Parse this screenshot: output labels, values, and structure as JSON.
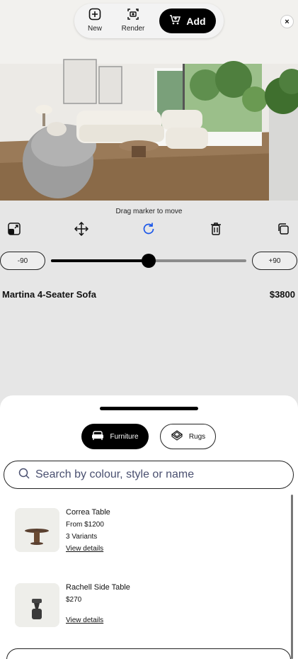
{
  "toolbar": {
    "new_label": "New",
    "render_label": "Render",
    "add_label": "Add"
  },
  "close": {
    "symbol": "×"
  },
  "hint": "Drag marker to move",
  "rotation": {
    "min_label": "-90",
    "max_label": "+90",
    "value_fraction": 0.5
  },
  "selected_product": {
    "name": "Martina 4-Seater Sofa",
    "price": "$3800"
  },
  "tabs": [
    {
      "label": "Furniture",
      "active": true
    },
    {
      "label": "Rugs",
      "active": false
    }
  ],
  "search": {
    "placeholder": "Search by colour, style or name"
  },
  "products": [
    {
      "title": "Correa Table",
      "price": "From $1200",
      "variants": "3 Variants",
      "link": "View details"
    },
    {
      "title": "Rachell Side Table",
      "price": "$270",
      "link": "View details"
    }
  ],
  "colors": {
    "accent_blue": "#1a56e8",
    "black": "#000000"
  },
  "icons": [
    "plus-square-icon",
    "render-camera-icon",
    "cart-icon",
    "close-icon",
    "resize-icon",
    "move-icon",
    "rotate-icon",
    "trash-icon",
    "duplicate-icon",
    "sofa-icon",
    "rug-icon",
    "search-icon"
  ]
}
